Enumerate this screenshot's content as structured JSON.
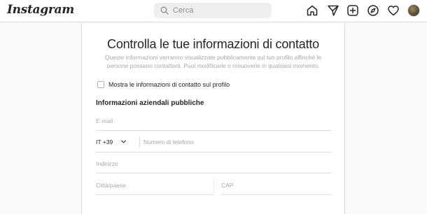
{
  "app": {
    "logo_text": "Instagram"
  },
  "search": {
    "placeholder": "Cerca",
    "icon": "search-icon"
  },
  "nav": {
    "icons": [
      "home-icon",
      "paper-plane-icon",
      "new-post-icon",
      "explore-compass-icon",
      "heart-icon",
      "profile-avatar"
    ]
  },
  "contact_form": {
    "title": "Controlla le tue informazioni di contatto",
    "description": "Queste informazioni verranno visualizzate pubblicamente sul tuo profilo affinché le persone possano contattarti. Puoi modificarle o rimuoverle in qualsiasi momento.",
    "show_on_profile_label": "Mostra le informazioni di contatto sul profilo",
    "show_on_profile_checked": false,
    "section_heading": "Informazioni aziendali pubbliche",
    "email": {
      "placeholder": "E-mail",
      "value": ""
    },
    "phone": {
      "country_code": "IT +39",
      "placeholder": "Numero di telefono",
      "value": ""
    },
    "address": {
      "placeholder": "Indirizzo",
      "value": ""
    },
    "city": {
      "placeholder": "Città/paese",
      "value": ""
    },
    "postal_code": {
      "placeholder": "CAP",
      "value": ""
    }
  },
  "colors": {
    "background": "#fafafa",
    "card": "#ffffff",
    "border": "#dbdbdb",
    "text": "#262626",
    "muted": "#a8a8a8"
  }
}
